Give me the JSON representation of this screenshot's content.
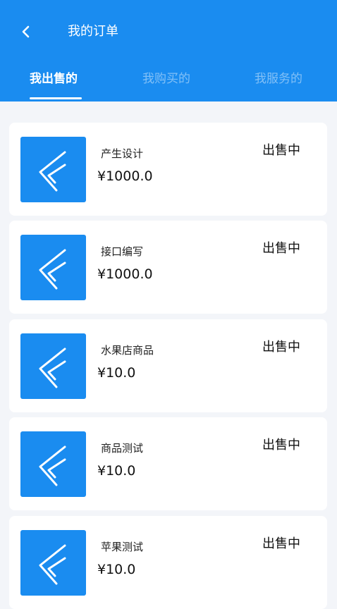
{
  "header": {
    "title": "我的订单",
    "back_icon": "chevron-left-icon",
    "background": "#1a8cf0"
  },
  "tabs": [
    {
      "label": "我出售的",
      "active": true
    },
    {
      "label": "我购买的",
      "active": false
    },
    {
      "label": "我服务的",
      "active": false
    }
  ],
  "orders": [
    {
      "name": "产生设计",
      "price": "¥1000.0",
      "status": "出售中",
      "thumb_icon": "logo-icon"
    },
    {
      "name": "接口编写",
      "price": "¥1000.0",
      "status": "出售中",
      "thumb_icon": "logo-icon"
    },
    {
      "name": "水果店商品",
      "price": "¥10.0",
      "status": "出售中",
      "thumb_icon": "logo-icon"
    },
    {
      "name": "商品测试",
      "price": "¥10.0",
      "status": "出售中",
      "thumb_icon": "logo-icon"
    },
    {
      "name": "苹果测试",
      "price": "¥10.0",
      "status": "出售中",
      "thumb_icon": "logo-icon"
    }
  ]
}
